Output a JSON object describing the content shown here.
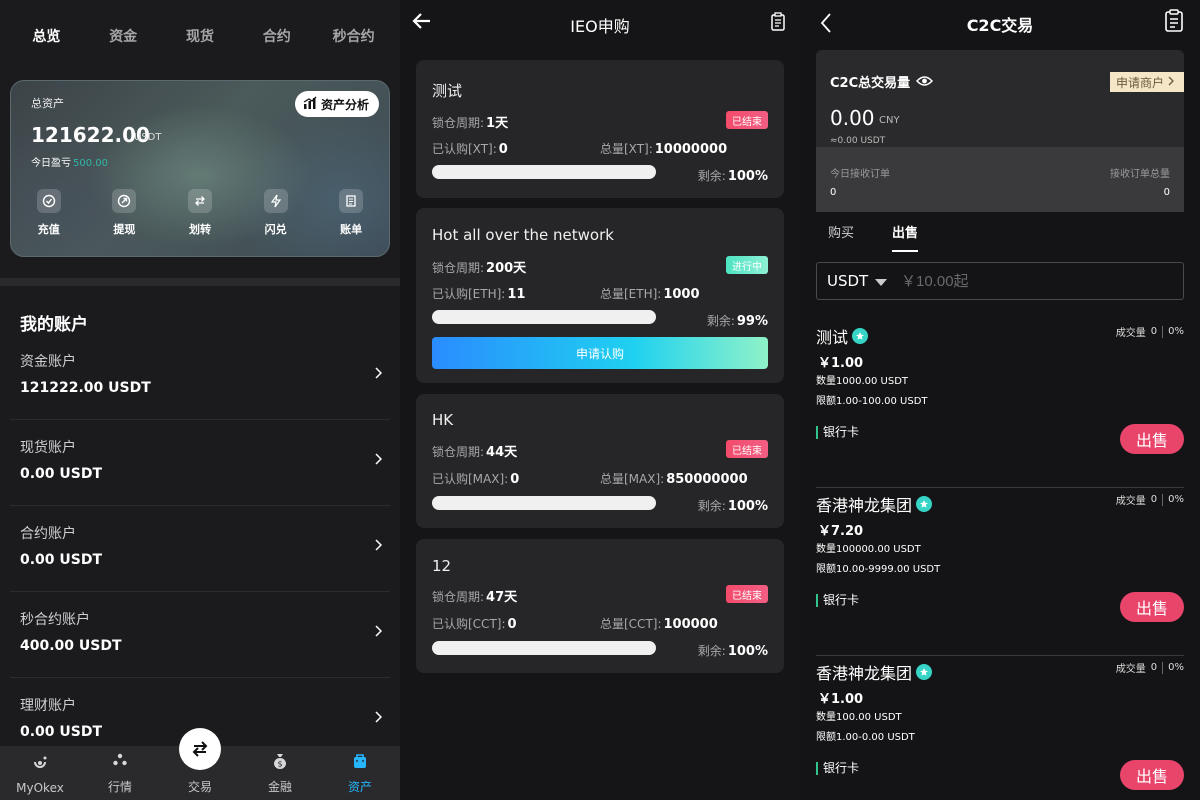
{
  "panel1": {
    "tabs": [
      "总览",
      "资金",
      "现货",
      "合约",
      "秒合约"
    ],
    "card": {
      "label": "总资产",
      "analysis_label": "资产分析",
      "amount": "121622.00",
      "unit": "USDT",
      "today_label": "今日盈亏",
      "today_value": "500.00",
      "actions": [
        {
          "label": "充值",
          "icon": "deposit-icon"
        },
        {
          "label": "提现",
          "icon": "withdraw-icon"
        },
        {
          "label": "划转",
          "icon": "transfer-icon"
        },
        {
          "label": "闪兑",
          "icon": "flash-exchange-icon"
        },
        {
          "label": "账单",
          "icon": "bill-icon"
        }
      ]
    },
    "accounts_title": "我的账户",
    "accounts": [
      {
        "name": "资金账户",
        "value": "121222.00 USDT"
      },
      {
        "name": "现货账户",
        "value": "0.00 USDT"
      },
      {
        "name": "合约账户",
        "value": "0.00 USDT"
      },
      {
        "name": "秒合约账户",
        "value": "400.00 USDT"
      },
      {
        "name": "理财账户",
        "value": "0.00 USDT"
      }
    ],
    "nav": [
      {
        "label": "MyOkex",
        "icon": "myokex-icon"
      },
      {
        "label": "行情",
        "icon": "market-icon"
      },
      {
        "label": "交易",
        "icon": "trade-icon"
      },
      {
        "label": "金融",
        "icon": "finance-icon"
      },
      {
        "label": "资产",
        "icon": "assets-icon"
      }
    ],
    "active_tab_color": "#26b5ff",
    "profit_color": "#2fb7a7"
  },
  "panel2": {
    "title": "IEO申购",
    "cards": [
      {
        "name": "测试",
        "status": "已结束",
        "lock_label": "锁仓周期:",
        "lock_value": "1天",
        "sub_label": "已认购[XT]:",
        "sub_value": "0",
        "total_label": "总量[XT]:",
        "total_value": "10000000",
        "remain_label": "剩余:",
        "remain_value": "100%"
      },
      {
        "name": "Hot all over the network",
        "status": "进行中",
        "lock_label": "锁仓周期:",
        "lock_value": "200天",
        "sub_label": "已认购[ETH]:",
        "sub_value": "11",
        "total_label": "总量[ETH]:",
        "total_value": "1000",
        "remain_label": "剩余:",
        "remain_value": "99%",
        "button": "申请认购"
      },
      {
        "name": "HK",
        "status": "已结束",
        "lock_label": "锁仓周期:",
        "lock_value": "44天",
        "sub_label": "已认购[MAX]:",
        "sub_value": "0",
        "total_label": "总量[MAX]:",
        "total_value": "850000000",
        "remain_label": "剩余:",
        "remain_value": "100%"
      },
      {
        "name": "12",
        "status": "已结束",
        "lock_label": "锁仓周期:",
        "lock_value": "47天",
        "sub_label": "已认购[CCT]:",
        "sub_value": "0",
        "total_label": "总量[CCT]:",
        "total_value": "100000",
        "remain_label": "剩余:",
        "remain_value": "100%"
      }
    ],
    "ended_color": "#f34b6b",
    "live_color": "#4de3c2"
  },
  "panel3": {
    "title": "C2C交易",
    "card": {
      "label": "C2C总交易量",
      "merchant_label": "申请商户",
      "amount": "0.00",
      "currency": "CNY",
      "sub": "≈0.00 USDT",
      "today_orders_label": "今日接收订单",
      "total_orders_label": "接收订单总量",
      "today_orders": "0",
      "total_orders": "0"
    },
    "tabs": [
      "购买",
      "出售"
    ],
    "filter": {
      "coin": "USDT",
      "placeholder": "￥10.00起"
    },
    "offers": [
      {
        "name": "测试",
        "deals_label": "成交量",
        "deals": "0",
        "rate": "0%",
        "price": "￥1.00",
        "qty": "数量1000.00 USDT",
        "limit": "限额1.00-100.00 USDT",
        "pay": "银行卡",
        "button": "出售"
      },
      {
        "name": "香港神龙集团",
        "deals_label": "成交量",
        "deals": "0",
        "rate": "0%",
        "price": "￥7.20",
        "qty": "数量100000.00 USDT",
        "limit": "限额10.00-9999.00 USDT",
        "pay": "银行卡",
        "button": "出售"
      },
      {
        "name": "香港神龙集团",
        "deals_label": "成交量",
        "deals": "0",
        "rate": "0%",
        "price": "￥1.00",
        "qty": "数量100.00 USDT",
        "limit": "限额1.00-0.00 USDT",
        "pay": "银行卡",
        "button": "出售"
      }
    ],
    "sell_color": "#e9456b"
  }
}
